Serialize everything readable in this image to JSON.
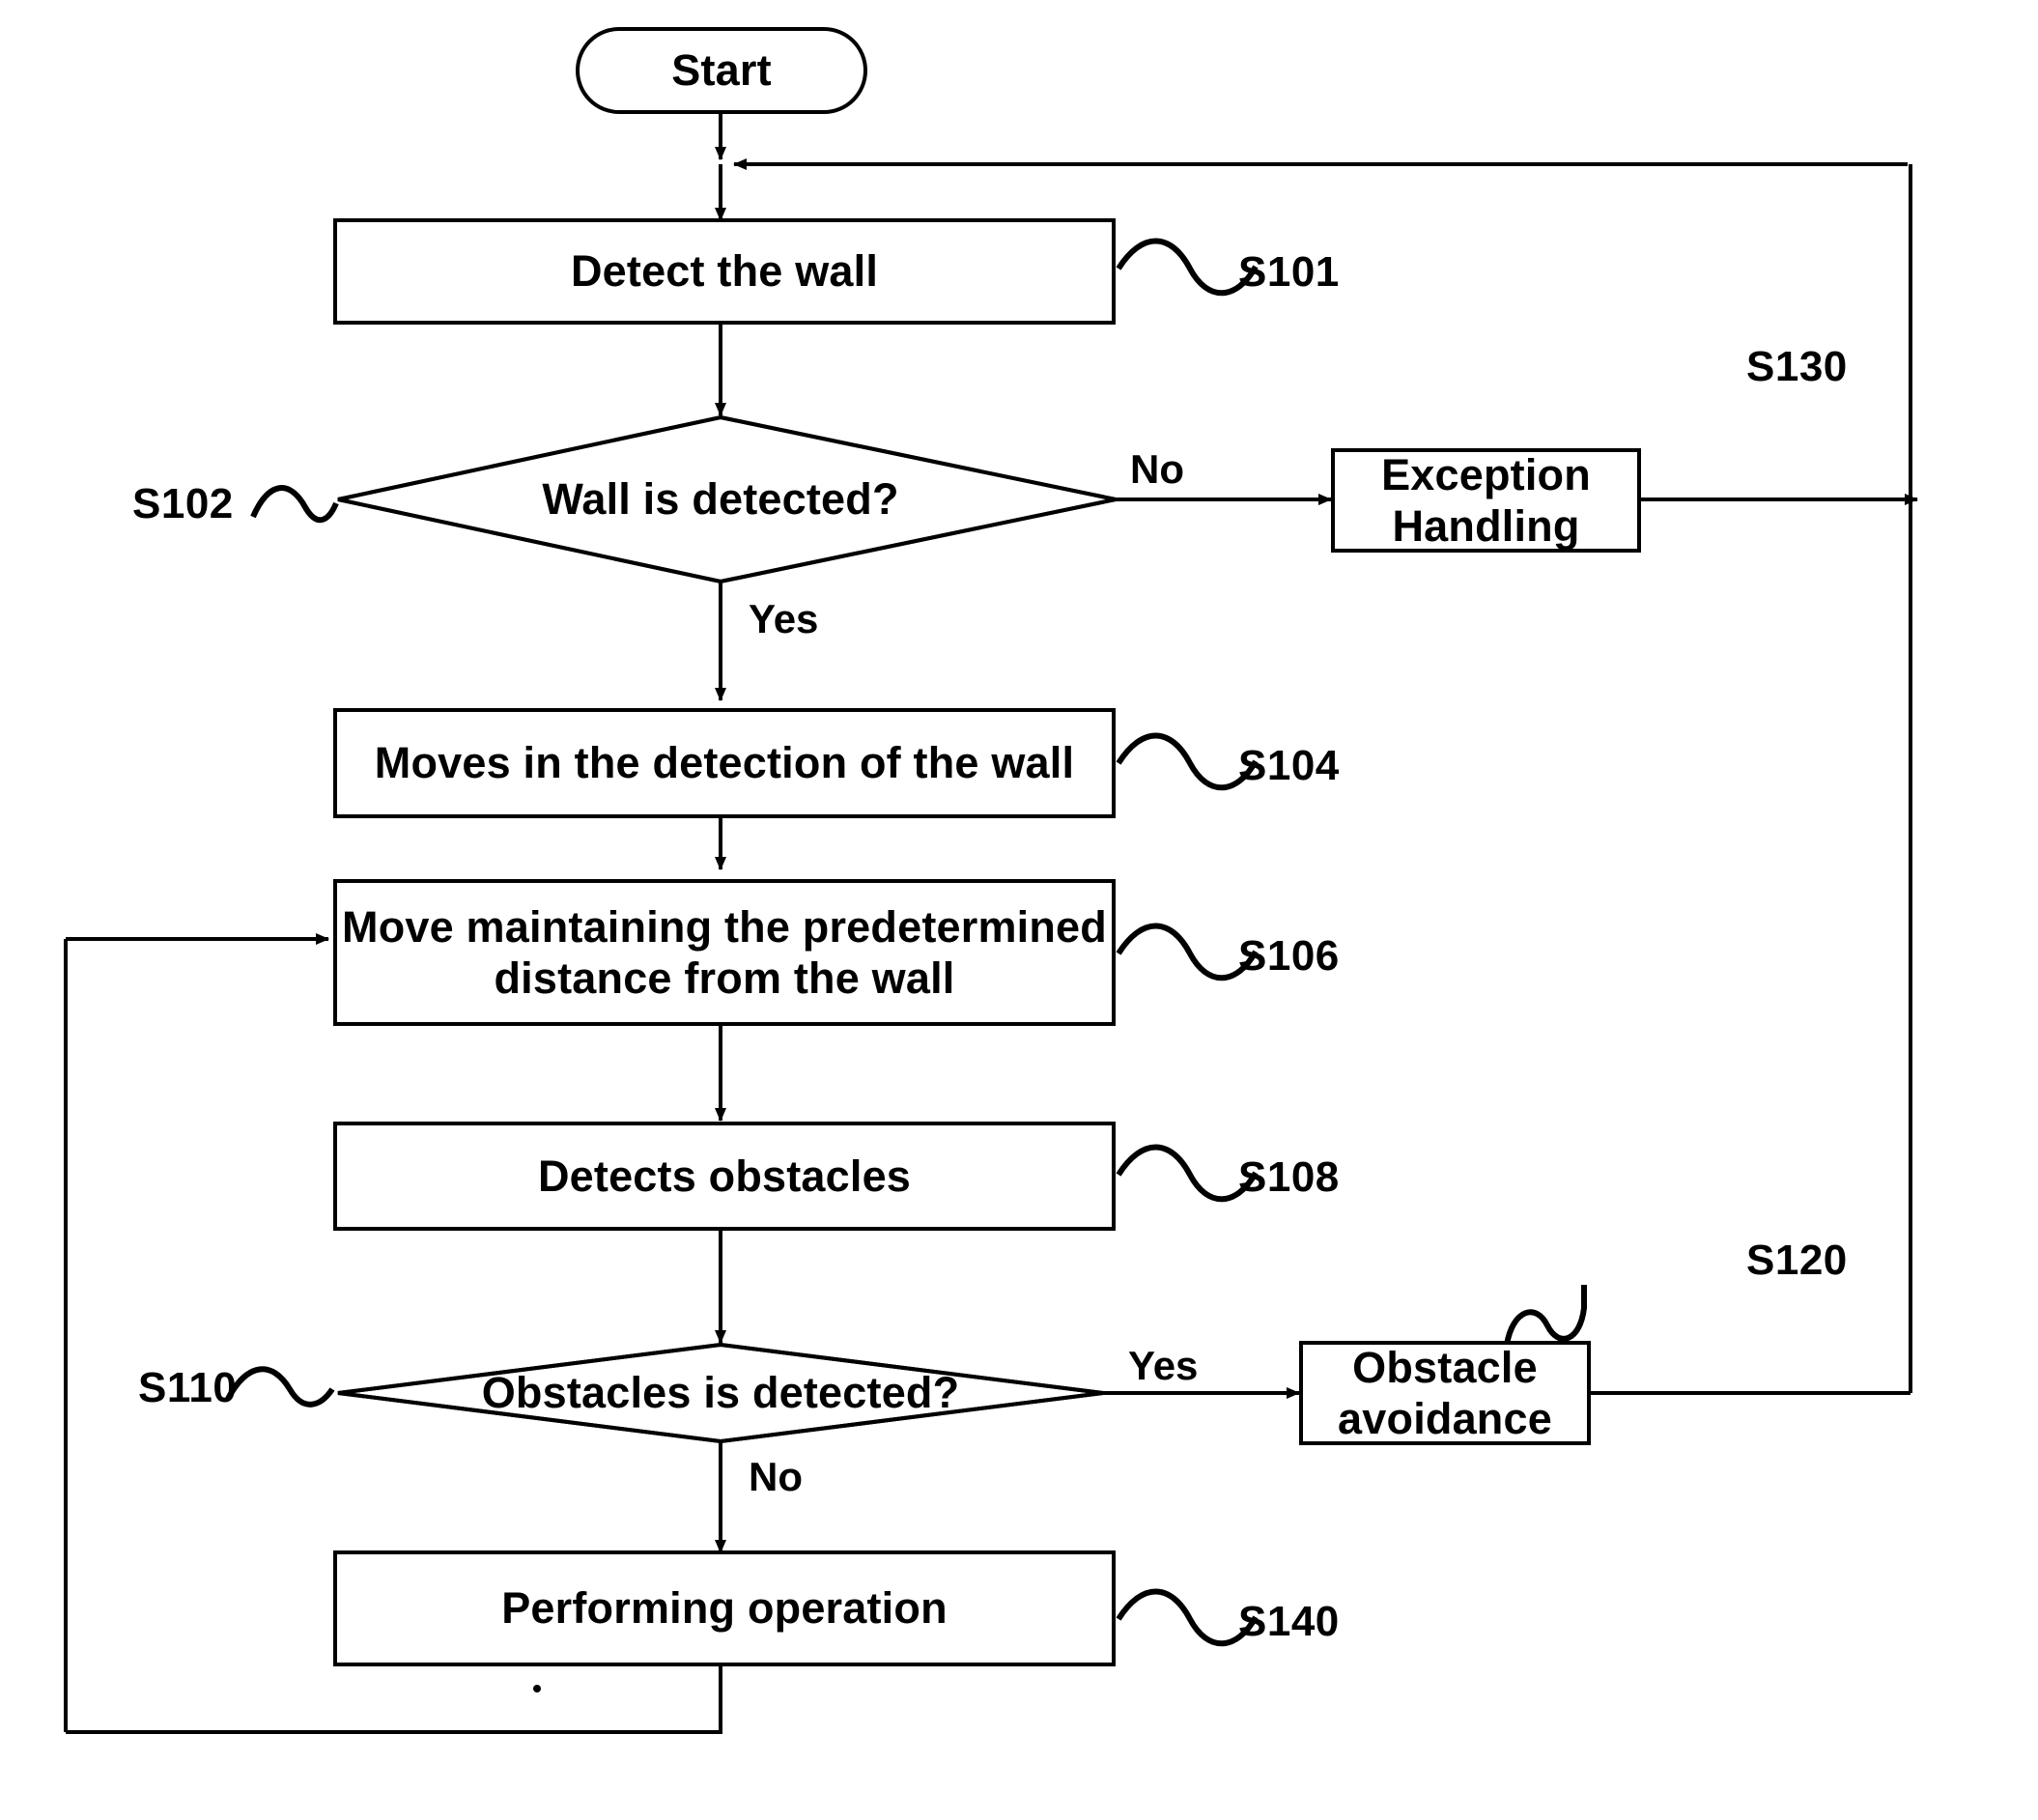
{
  "diagram": {
    "title": "Wall-following robot control flowchart",
    "stroke_color": "#000000",
    "background_color": "#ffffff"
  },
  "nodes": {
    "start": {
      "label": "Start",
      "shape": "stadium",
      "ref": ""
    },
    "detect_wall": {
      "label": "Detect the wall",
      "shape": "rect",
      "ref": "S101"
    },
    "wall_detected": {
      "label": "Wall is detected?",
      "shape": "diamond",
      "ref": "S102"
    },
    "exception_handling": {
      "label": "Exception Handling",
      "shape": "rect",
      "ref": "S130"
    },
    "moves_detection": {
      "label": "Moves in the detection of the wall",
      "shape": "rect",
      "ref": "S104"
    },
    "move_maintaining": {
      "label": "Move maintaining the predetermined\ndistance from the wall",
      "shape": "rect",
      "ref": "S106"
    },
    "detects_obstacles": {
      "label": "Detects obstacles",
      "shape": "rect",
      "ref": "S108"
    },
    "obstacles_detected": {
      "label": "Obstacles is detected?",
      "shape": "diamond",
      "ref": "S110"
    },
    "obstacle_avoidance": {
      "label": "Obstacle avoidance",
      "shape": "rect",
      "ref": "S120"
    },
    "performing_operation": {
      "label": "Performing operation",
      "shape": "rect",
      "ref": "S140"
    }
  },
  "edge_labels": {
    "wall_no": "No",
    "wall_yes": "Yes",
    "obstacle_yes": "Yes",
    "obstacle_no": "No"
  },
  "references": {
    "s101": "S101",
    "s102": "S102",
    "s104": "S104",
    "s106": "S106",
    "s108": "S108",
    "s110": "S110",
    "s120": "S120",
    "s130": "S130",
    "s140": "S140"
  }
}
